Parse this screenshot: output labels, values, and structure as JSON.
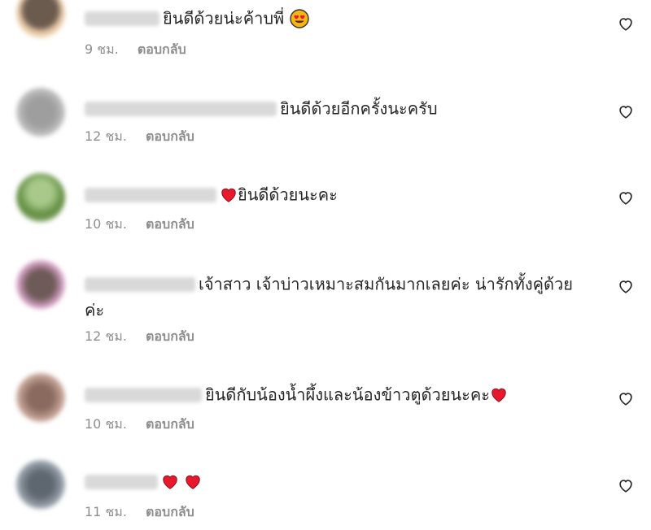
{
  "icons": {
    "like": "heart-outline-icon",
    "emoji_heart": "red-heart-emoji",
    "emoji_face": "heart-eyes-emoji"
  },
  "colors": {
    "avatar_1": "#e9c9a8",
    "avatar_2": "#bdbdbd",
    "avatar_3": "#7aa35e",
    "avatar_4": "#d7a4c8",
    "avatar_5": "#c8a79a",
    "avatar_6": "#9aa3ad",
    "heart": "#e8192c",
    "meta_text": "#8e8e8e"
  },
  "comments": [
    {
      "text": "ยินดีด้วยน่ะค้าบพี่",
      "time": "9 ชม.",
      "reply": "ตอบกลับ"
    },
    {
      "text": "ยินดีด้วยอีกครั้งนะครับ",
      "time": "12 ชม.",
      "reply": "ตอบกลับ"
    },
    {
      "text": "ยินดีด้วยนะคะ",
      "time": "10 ชม.",
      "reply": "ตอบกลับ"
    },
    {
      "text": "เจ้าสาว เจ้าบ่าวเหมาะสมกันมากเลยค่ะ น่ารักทั้งคู่ด้วย",
      "text_cont": "ค่ะ",
      "time": "12 ชม.",
      "reply": "ตอบกลับ"
    },
    {
      "text": "ยินดีกับน้องน้ำผึ้งและน้องข้าวตูด้วยนะคะ",
      "time": "10 ชม.",
      "reply": "ตอบกลับ"
    },
    {
      "text": "",
      "time": "11 ชม.",
      "reply": "ตอบกลับ"
    }
  ]
}
